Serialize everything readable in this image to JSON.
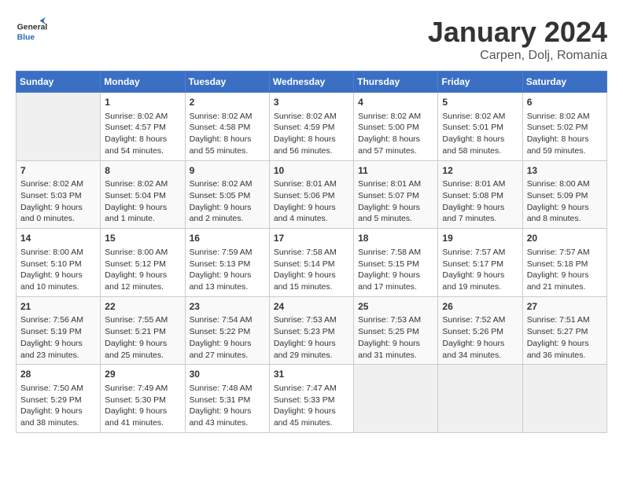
{
  "header": {
    "logo_general": "General",
    "logo_blue": "Blue",
    "month_title": "January 2024",
    "location": "Carpen, Dolj, Romania"
  },
  "days_of_week": [
    "Sunday",
    "Monday",
    "Tuesday",
    "Wednesday",
    "Thursday",
    "Friday",
    "Saturday"
  ],
  "weeks": [
    [
      {
        "day": "",
        "sunrise": "",
        "sunset": "",
        "daylight": "",
        "empty": true
      },
      {
        "day": "1",
        "sunrise": "Sunrise: 8:02 AM",
        "sunset": "Sunset: 4:57 PM",
        "daylight": "Daylight: 8 hours and 54 minutes."
      },
      {
        "day": "2",
        "sunrise": "Sunrise: 8:02 AM",
        "sunset": "Sunset: 4:58 PM",
        "daylight": "Daylight: 8 hours and 55 minutes."
      },
      {
        "day": "3",
        "sunrise": "Sunrise: 8:02 AM",
        "sunset": "Sunset: 4:59 PM",
        "daylight": "Daylight: 8 hours and 56 minutes."
      },
      {
        "day": "4",
        "sunrise": "Sunrise: 8:02 AM",
        "sunset": "Sunset: 5:00 PM",
        "daylight": "Daylight: 8 hours and 57 minutes."
      },
      {
        "day": "5",
        "sunrise": "Sunrise: 8:02 AM",
        "sunset": "Sunset: 5:01 PM",
        "daylight": "Daylight: 8 hours and 58 minutes."
      },
      {
        "day": "6",
        "sunrise": "Sunrise: 8:02 AM",
        "sunset": "Sunset: 5:02 PM",
        "daylight": "Daylight: 8 hours and 59 minutes."
      }
    ],
    [
      {
        "day": "7",
        "sunrise": "Sunrise: 8:02 AM",
        "sunset": "Sunset: 5:03 PM",
        "daylight": "Daylight: 9 hours and 0 minutes."
      },
      {
        "day": "8",
        "sunrise": "Sunrise: 8:02 AM",
        "sunset": "Sunset: 5:04 PM",
        "daylight": "Daylight: 9 hours and 1 minute."
      },
      {
        "day": "9",
        "sunrise": "Sunrise: 8:02 AM",
        "sunset": "Sunset: 5:05 PM",
        "daylight": "Daylight: 9 hours and 2 minutes."
      },
      {
        "day": "10",
        "sunrise": "Sunrise: 8:01 AM",
        "sunset": "Sunset: 5:06 PM",
        "daylight": "Daylight: 9 hours and 4 minutes."
      },
      {
        "day": "11",
        "sunrise": "Sunrise: 8:01 AM",
        "sunset": "Sunset: 5:07 PM",
        "daylight": "Daylight: 9 hours and 5 minutes."
      },
      {
        "day": "12",
        "sunrise": "Sunrise: 8:01 AM",
        "sunset": "Sunset: 5:08 PM",
        "daylight": "Daylight: 9 hours and 7 minutes."
      },
      {
        "day": "13",
        "sunrise": "Sunrise: 8:00 AM",
        "sunset": "Sunset: 5:09 PM",
        "daylight": "Daylight: 9 hours and 8 minutes."
      }
    ],
    [
      {
        "day": "14",
        "sunrise": "Sunrise: 8:00 AM",
        "sunset": "Sunset: 5:10 PM",
        "daylight": "Daylight: 9 hours and 10 minutes."
      },
      {
        "day": "15",
        "sunrise": "Sunrise: 8:00 AM",
        "sunset": "Sunset: 5:12 PM",
        "daylight": "Daylight: 9 hours and 12 minutes."
      },
      {
        "day": "16",
        "sunrise": "Sunrise: 7:59 AM",
        "sunset": "Sunset: 5:13 PM",
        "daylight": "Daylight: 9 hours and 13 minutes."
      },
      {
        "day": "17",
        "sunrise": "Sunrise: 7:58 AM",
        "sunset": "Sunset: 5:14 PM",
        "daylight": "Daylight: 9 hours and 15 minutes."
      },
      {
        "day": "18",
        "sunrise": "Sunrise: 7:58 AM",
        "sunset": "Sunset: 5:15 PM",
        "daylight": "Daylight: 9 hours and 17 minutes."
      },
      {
        "day": "19",
        "sunrise": "Sunrise: 7:57 AM",
        "sunset": "Sunset: 5:17 PM",
        "daylight": "Daylight: 9 hours and 19 minutes."
      },
      {
        "day": "20",
        "sunrise": "Sunrise: 7:57 AM",
        "sunset": "Sunset: 5:18 PM",
        "daylight": "Daylight: 9 hours and 21 minutes."
      }
    ],
    [
      {
        "day": "21",
        "sunrise": "Sunrise: 7:56 AM",
        "sunset": "Sunset: 5:19 PM",
        "daylight": "Daylight: 9 hours and 23 minutes."
      },
      {
        "day": "22",
        "sunrise": "Sunrise: 7:55 AM",
        "sunset": "Sunset: 5:21 PM",
        "daylight": "Daylight: 9 hours and 25 minutes."
      },
      {
        "day": "23",
        "sunrise": "Sunrise: 7:54 AM",
        "sunset": "Sunset: 5:22 PM",
        "daylight": "Daylight: 9 hours and 27 minutes."
      },
      {
        "day": "24",
        "sunrise": "Sunrise: 7:53 AM",
        "sunset": "Sunset: 5:23 PM",
        "daylight": "Daylight: 9 hours and 29 minutes."
      },
      {
        "day": "25",
        "sunrise": "Sunrise: 7:53 AM",
        "sunset": "Sunset: 5:25 PM",
        "daylight": "Daylight: 9 hours and 31 minutes."
      },
      {
        "day": "26",
        "sunrise": "Sunrise: 7:52 AM",
        "sunset": "Sunset: 5:26 PM",
        "daylight": "Daylight: 9 hours and 34 minutes."
      },
      {
        "day": "27",
        "sunrise": "Sunrise: 7:51 AM",
        "sunset": "Sunset: 5:27 PM",
        "daylight": "Daylight: 9 hours and 36 minutes."
      }
    ],
    [
      {
        "day": "28",
        "sunrise": "Sunrise: 7:50 AM",
        "sunset": "Sunset: 5:29 PM",
        "daylight": "Daylight: 9 hours and 38 minutes."
      },
      {
        "day": "29",
        "sunrise": "Sunrise: 7:49 AM",
        "sunset": "Sunset: 5:30 PM",
        "daylight": "Daylight: 9 hours and 41 minutes."
      },
      {
        "day": "30",
        "sunrise": "Sunrise: 7:48 AM",
        "sunset": "Sunset: 5:31 PM",
        "daylight": "Daylight: 9 hours and 43 minutes."
      },
      {
        "day": "31",
        "sunrise": "Sunrise: 7:47 AM",
        "sunset": "Sunset: 5:33 PM",
        "daylight": "Daylight: 9 hours and 45 minutes."
      },
      {
        "day": "",
        "sunrise": "",
        "sunset": "",
        "daylight": "",
        "empty": true
      },
      {
        "day": "",
        "sunrise": "",
        "sunset": "",
        "daylight": "",
        "empty": true
      },
      {
        "day": "",
        "sunrise": "",
        "sunset": "",
        "daylight": "",
        "empty": true
      }
    ]
  ]
}
